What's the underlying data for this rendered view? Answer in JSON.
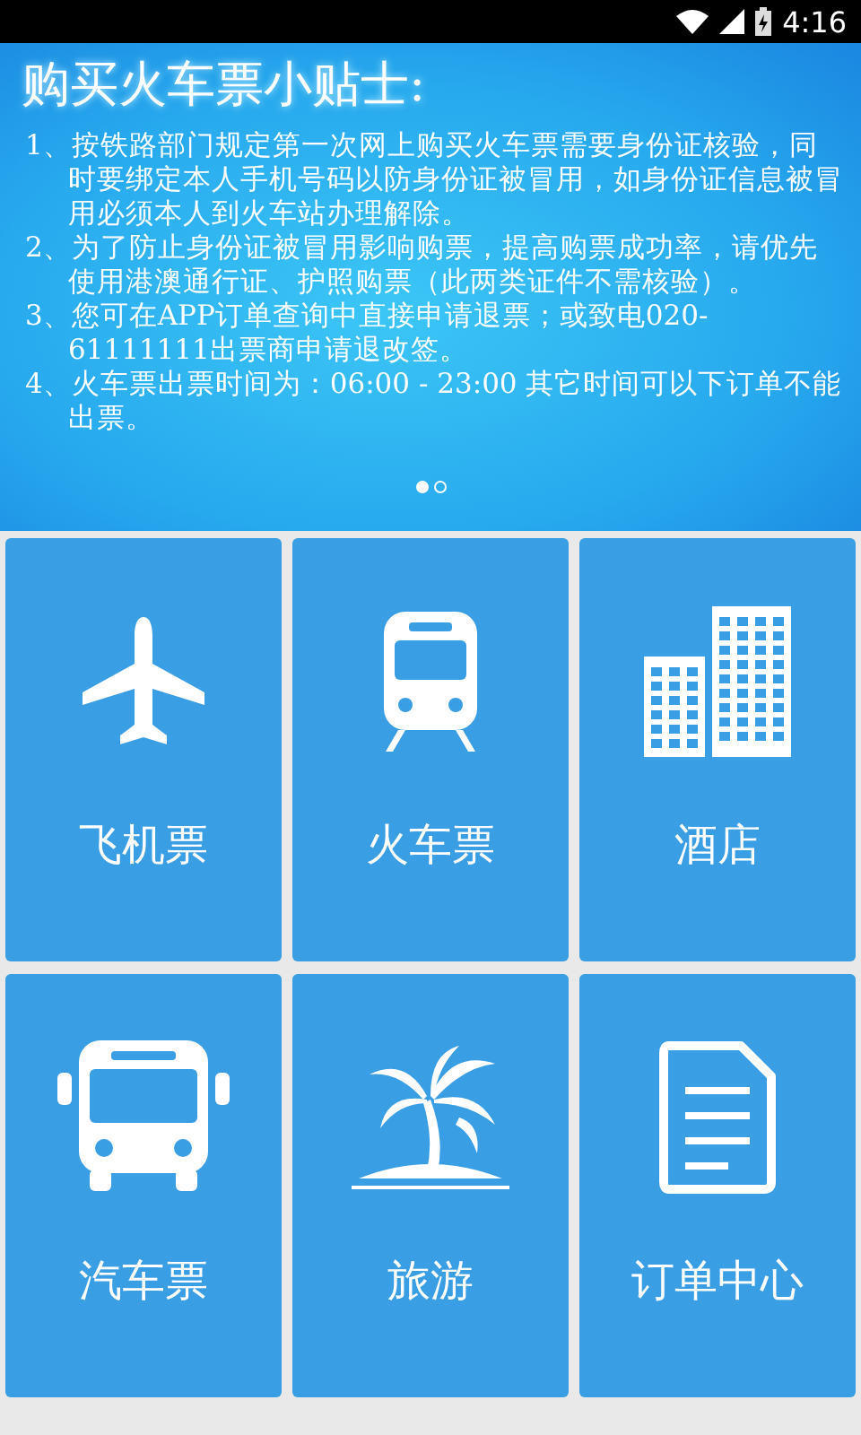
{
  "status_bar": {
    "time": "4:16"
  },
  "banner": {
    "title": "购买火车票小贴士:",
    "tips": [
      "1、按铁路部门规定第一次网上购买火车票需要身份证核验，同时要绑定本人手机号码以防身份证被冒用，如身份证信息被冒用必须本人到火车站办理解除。",
      "2、为了防止身份证被冒用影响购票，提高购票成功率，请优先使用港澳通行证、护照购票（此两类证件不需核验）。",
      "3、您可在APP订单查询中直接申请退票；或致电020-61111111出票商申请退改签。",
      "4、火车票出票时间为：06:00 - 23:00 其它时间可以下订单不能出票。"
    ],
    "pages": [
      {
        "selected": true
      },
      {
        "selected": false
      }
    ]
  },
  "tiles": [
    {
      "kind": "plane",
      "label": "飞机票"
    },
    {
      "kind": "train",
      "label": "火车票"
    },
    {
      "kind": "hotel",
      "label": "酒店"
    },
    {
      "kind": "bus",
      "label": "汽车票"
    },
    {
      "kind": "travel",
      "label": "旅游"
    },
    {
      "kind": "orders",
      "label": "订单中心"
    }
  ]
}
